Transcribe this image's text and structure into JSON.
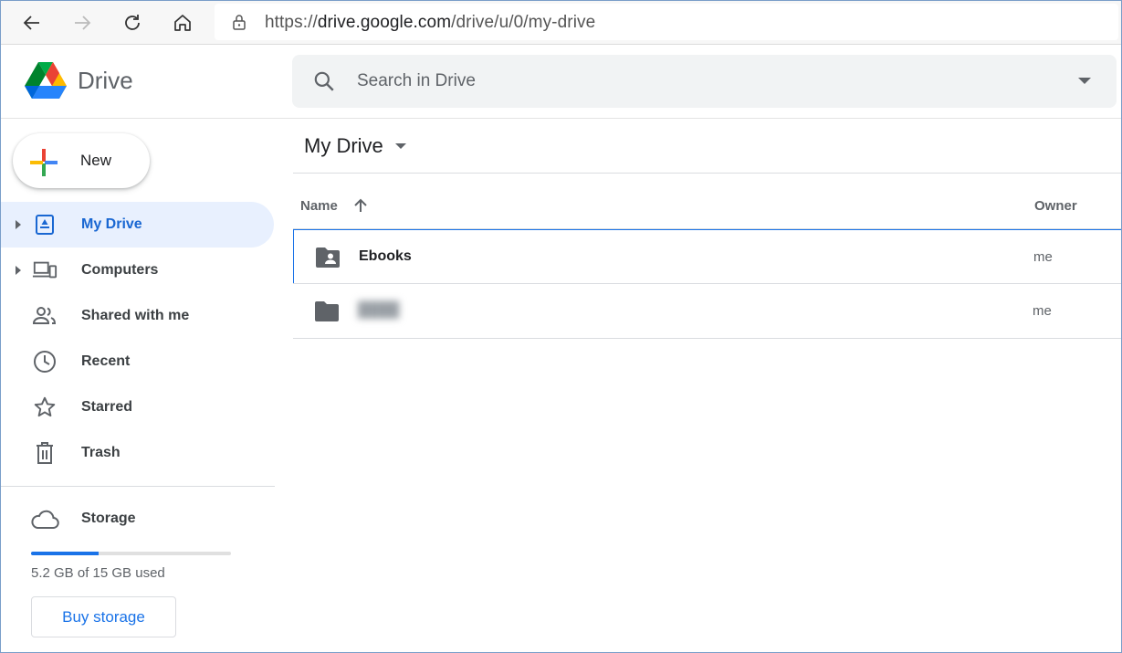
{
  "browser": {
    "url_prefix": "https://",
    "url_host": "drive.google.com",
    "url_path": "/drive/u/0/my-drive"
  },
  "header": {
    "app_name": "Drive",
    "search_placeholder": "Search in Drive"
  },
  "sidebar": {
    "new_label": "New",
    "items": [
      {
        "label": "My Drive",
        "icon": "my-drive-icon",
        "active": true,
        "expandable": true
      },
      {
        "label": "Computers",
        "icon": "computers-icon",
        "active": false,
        "expandable": true
      },
      {
        "label": "Shared with me",
        "icon": "shared-icon",
        "active": false,
        "expandable": false
      },
      {
        "label": "Recent",
        "icon": "clock-icon",
        "active": false,
        "expandable": false
      },
      {
        "label": "Starred",
        "icon": "star-icon",
        "active": false,
        "expandable": false
      },
      {
        "label": "Trash",
        "icon": "trash-icon",
        "active": false,
        "expandable": false
      }
    ],
    "storage": {
      "label": "Storage",
      "usage_text": "5.2 GB of 15 GB used",
      "used_fraction": 0.34,
      "buy_label": "Buy storage"
    }
  },
  "main": {
    "title": "My Drive",
    "columns": {
      "name": "Name",
      "owner": "Owner"
    },
    "rows": [
      {
        "name": "Ebooks",
        "icon": "shared-folder-icon",
        "owner": "me",
        "selected": true,
        "blurred": false
      },
      {
        "name": "",
        "icon": "folder-icon",
        "owner": "me",
        "selected": false,
        "blurred": true
      }
    ]
  },
  "colors": {
    "accent": "#1a73e8",
    "active_bg": "#e8f0fe",
    "active_text": "#1967d2"
  }
}
